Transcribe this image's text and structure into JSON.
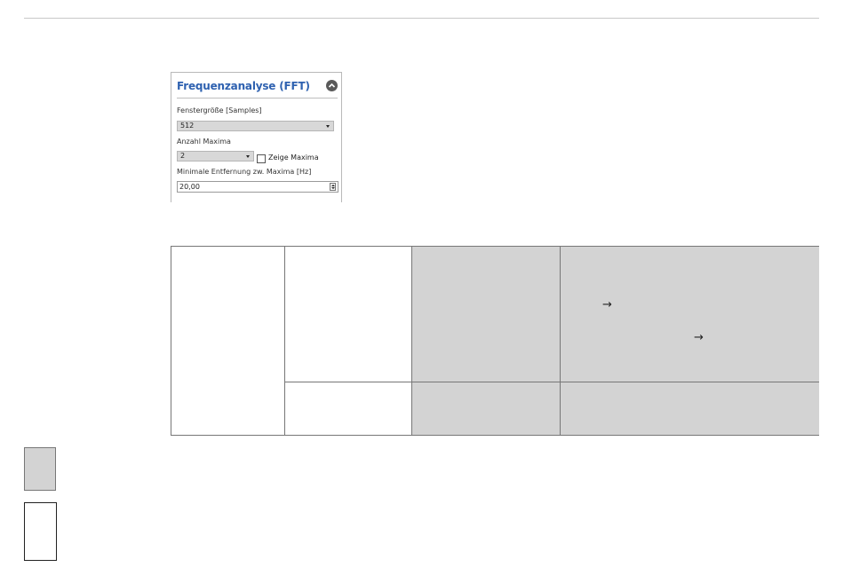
{
  "panel": {
    "title": "Frequenzanalyse (FFT)",
    "window_size_label": "Fenstergröße [Samples]",
    "window_size_value": "512",
    "max_count_label": "Anzahl Maxima",
    "max_count_value": "2",
    "show_maxima_label": "Zeige Maxima",
    "show_maxima_checked": false,
    "min_distance_label": "Minimale Entfernung zw. Maxima [Hz]",
    "min_distance_value": "20,00"
  },
  "table": {
    "arrows": [
      "→",
      "→"
    ]
  },
  "colors": {
    "title_blue": "#2e61b0",
    "cell_gray": "#d3d3d3",
    "border": "#777777"
  }
}
